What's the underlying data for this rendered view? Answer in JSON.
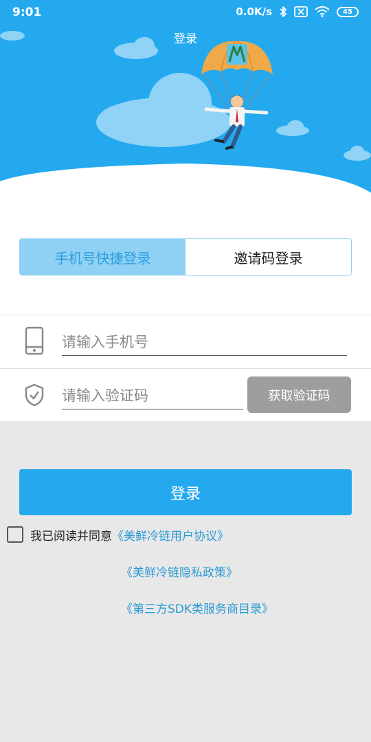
{
  "status_bar": {
    "time": "9:01",
    "network_speed": "0.0K/s",
    "battery": "45",
    "icons": [
      "bluetooth-icon",
      "sim-x-icon",
      "wifi-icon",
      "battery-icon"
    ]
  },
  "header": {
    "title": "登录"
  },
  "tabs": {
    "phone_quick_login": "手机号快捷登录",
    "invite_code_login": "邀请码登录"
  },
  "form": {
    "phone_placeholder": "请输入手机号",
    "code_placeholder": "请输入验证码",
    "get_code_button": "获取验证码"
  },
  "login_button": "登录",
  "agreement": {
    "prefix": "我已阅读并同意",
    "user_agreement": "《美鲜冷链用户协议》",
    "privacy_policy": "《美鲜冷链隐私政策》",
    "third_party_sdk": "《第三方SDK类服务商目录》"
  },
  "colors": {
    "primary": "#24a9ef",
    "tab_active_bg": "#8fd0f5",
    "link": "#2a9ad5",
    "disabled_button": "#9e9e9e",
    "page_bg": "#e8e8e8"
  }
}
